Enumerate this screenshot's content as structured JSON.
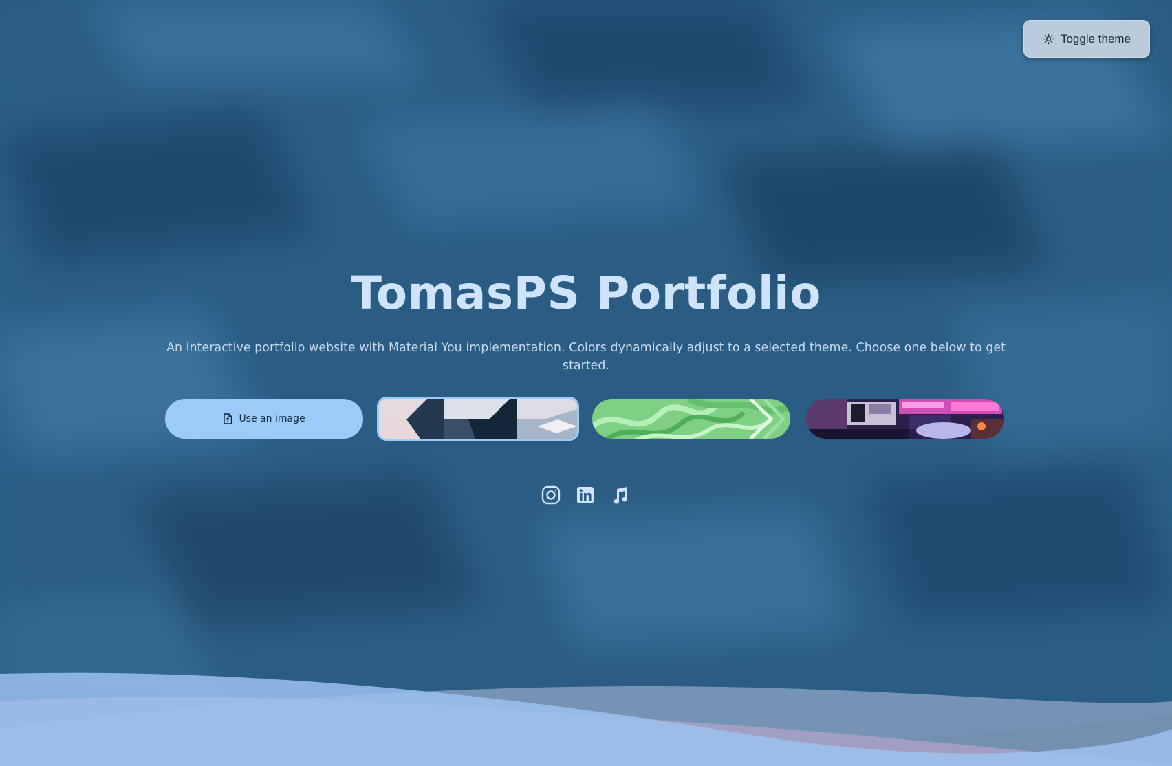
{
  "header": {
    "toggle_label": "Toggle theme",
    "toggle_icon": "sun-icon"
  },
  "hero": {
    "title": "TomasPS Portfolio",
    "subtitle": "An interactive portfolio website with Material You implementation. Colors dynamically adjust to a selected theme. Choose one below to get started."
  },
  "themes": {
    "use_image_label": "Use an image",
    "use_image_icon": "file-upload-icon",
    "options": [
      {
        "id": "isometric-blocks",
        "selected": true
      },
      {
        "id": "green-waves",
        "selected": false
      },
      {
        "id": "neon-shop",
        "selected": false
      }
    ]
  },
  "socials": [
    {
      "icon": "instagram-icon"
    },
    {
      "icon": "linkedin-icon"
    },
    {
      "icon": "music-note-icon"
    }
  ],
  "colors": {
    "background": "#2c5f86",
    "primary": "#9ccbf9",
    "title": "#cfe3fb",
    "toggle_bg": "#bccbdc"
  }
}
